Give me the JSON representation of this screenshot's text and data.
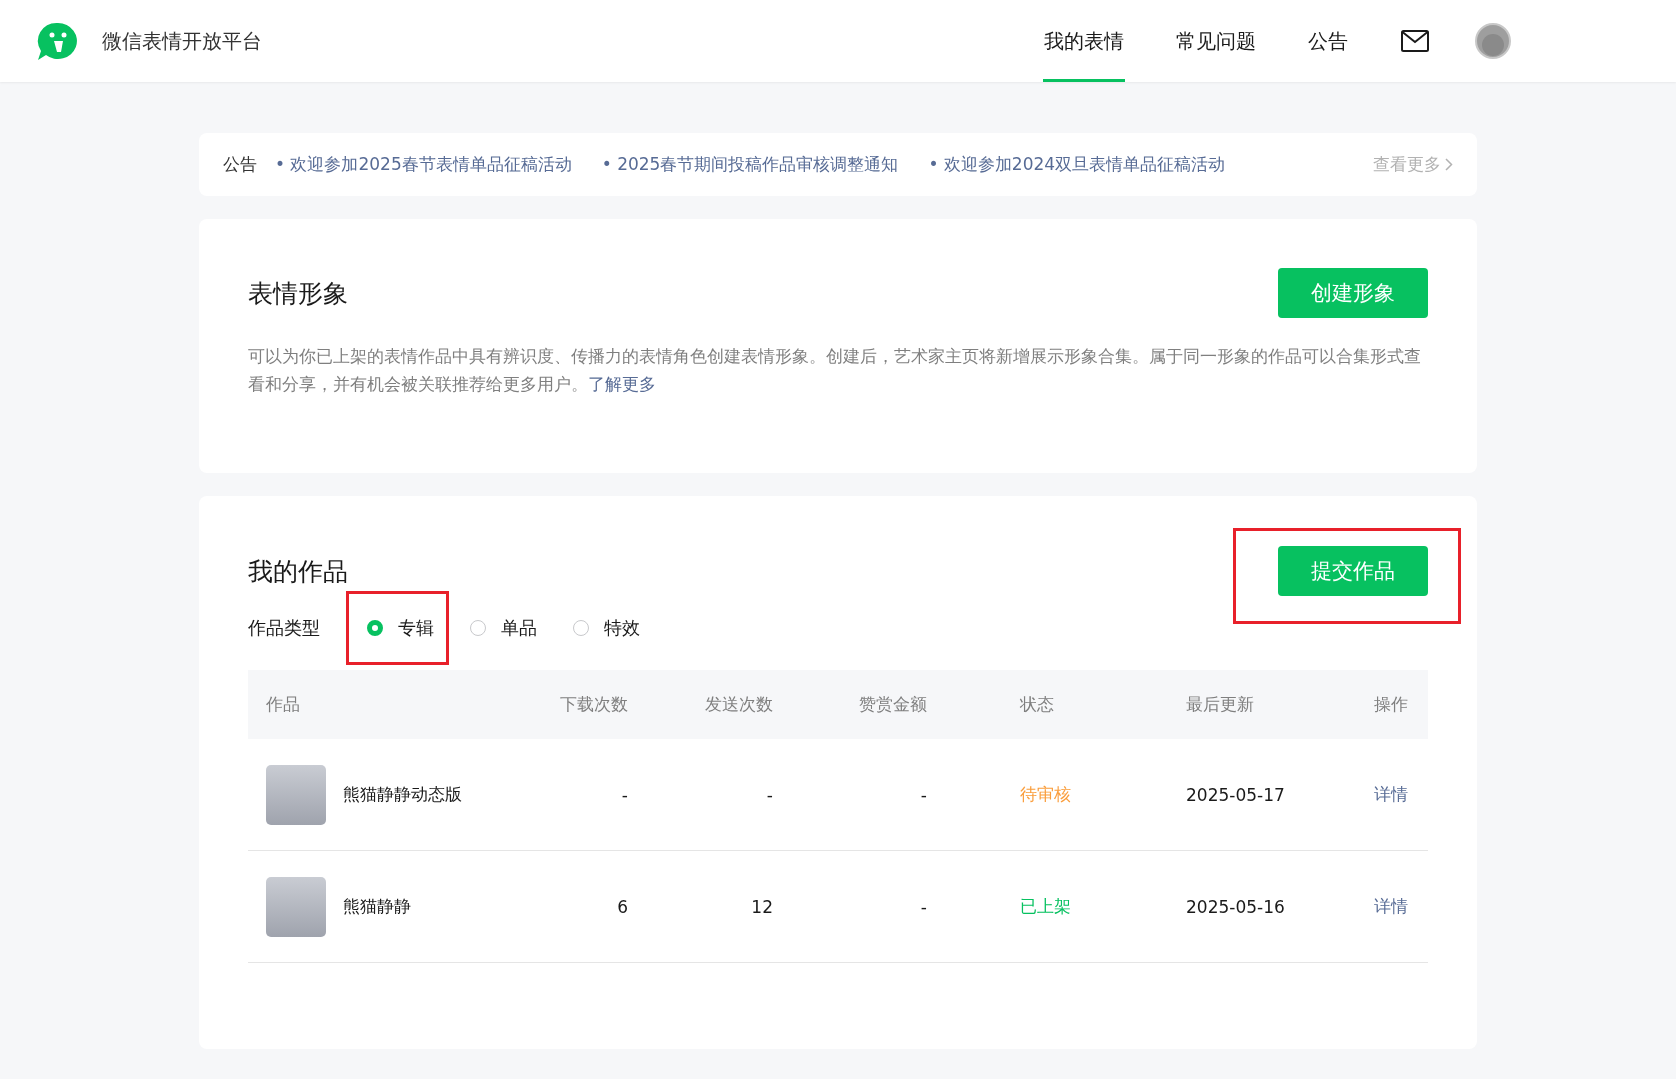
{
  "header": {
    "site_title": "微信表情开放平台",
    "nav": [
      {
        "label": "我的表情",
        "selected": true
      },
      {
        "label": "常见问题",
        "selected": false
      },
      {
        "label": "公告",
        "selected": false
      }
    ]
  },
  "notice_bar": {
    "label": "公告",
    "items": [
      "• 欢迎参加2025春节表情单品征稿活动",
      "• 2025春节期间投稿作品审核调整通知",
      "• 欢迎参加2024双旦表情单品征稿活动"
    ],
    "more": "查看更多"
  },
  "persona": {
    "title": "表情形象",
    "button": "创建形象",
    "description": "可以为你已上架的表情作品中具有辨识度、传播力的表情角色创建表情形象。创建后，艺术家主页将新增展示形象合集。属于同一形象的作品可以合集形式查看和分享，并有机会被关联推荐给更多用户。",
    "link": "了解更多"
  },
  "works": {
    "title": "我的作品",
    "button": {
      "label": "提交作品",
      "highlighted": true
    },
    "type_label": "作品类型",
    "types": [
      {
        "label": "专辑",
        "selected": true,
        "highlighted": true
      },
      {
        "label": "单品",
        "selected": false,
        "highlighted": false
      },
      {
        "label": "特效",
        "selected": false,
        "highlighted": false
      }
    ],
    "table": {
      "columns": [
        "作品",
        "下载次数",
        "发送次数",
        "赞赏金额",
        "状态",
        "最后更新",
        "操作"
      ],
      "rows": [
        {
          "name": "熊猫静静动态版",
          "downloads": "-",
          "sends": "-",
          "reward": "-",
          "status": "待审核",
          "kind": "pending",
          "updated": "2025-05-17",
          "action": "详情"
        },
        {
          "name": "熊猫静静",
          "downloads": "6",
          "sends": "12",
          "reward": "-",
          "status": "已上架",
          "kind": "live",
          "updated": "2025-05-16",
          "action": "详情"
        }
      ]
    }
  }
}
